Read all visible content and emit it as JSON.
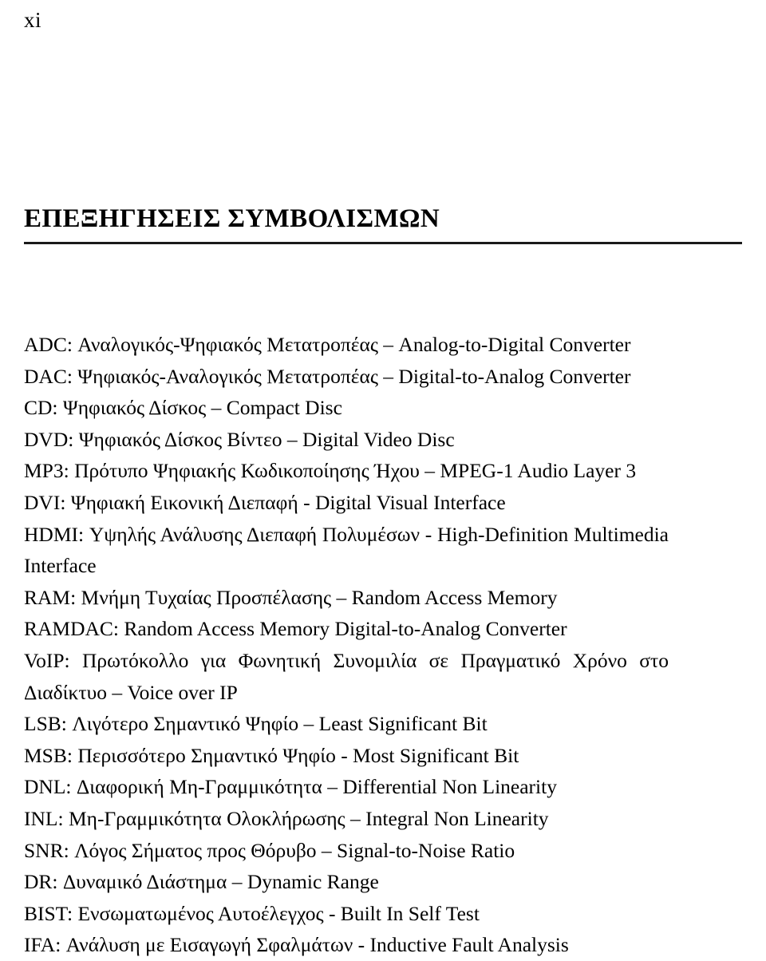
{
  "page": {
    "folio": "xi",
    "heading": "ΕΠΕΞΗΓΗΣΕΙΣ ΣΥΜΒΟΛΙΣΜΩΝ"
  },
  "glossary": {
    "entries": [
      {
        "text": "ADC: Αναλογικός-Ψηφιακός Μετατροπέας – Analog-to-Digital Converter"
      },
      {
        "text": "DAC: Ψηφιακός-Αναλογικός Μετατροπέας – Digital-to-Analog Converter"
      },
      {
        "text": "CD: Ψηφιακός Δίσκος – Compact Disc"
      },
      {
        "text": "DVD: Ψηφιακός Δίσκος Βίντεο – Digital Video Disc"
      },
      {
        "text": "MP3: Πρότυπο Ψηφιακής Κωδικοποίησης Ήχου – MPEG-1 Audio Layer 3"
      },
      {
        "text": "DVI: Ψηφιακή Εικονική Διεπαφή - Digital Visual Interface"
      },
      {
        "text": "HDMI: Υψηλής Ανάλυσης Διεπαφή Πολυμέσων - High-Definition Multimedia Interface"
      },
      {
        "text": "RAM: Μνήμη Τυχαίας Προσπέλασης – Random Access Memory"
      },
      {
        "text": "RAMDAC: Random Access Memory Digital-to-Analog Converter"
      },
      {
        "text": "VoIP: Πρωτόκολλο για Φωνητική Συνομιλία σε Πραγματικό Χρόνο στο Διαδίκτυο – Voice over IP"
      },
      {
        "text": "LSB: Λιγότερο Σημαντικό Ψηφίο – Least Significant Bit"
      },
      {
        "text": "MSB: Περισσότερο Σημαντικό Ψηφίο - Most Significant Bit"
      },
      {
        "text": "DNL: Διαφορική Μη-Γραμμικότητα – Differential Non Linearity"
      },
      {
        "text": "INL: Μη-Γραμμικότητα Ολοκλήρωσης – Integral Non Linearity"
      },
      {
        "text": "SNR: Λόγος Σήματος προς Θόρυβο – Signal-to-Noise Ratio"
      },
      {
        "text": "DR: Δυναμικό Διάστημα – Dynamic Range"
      },
      {
        "text": "BIST: Ενσωματωμένος Αυτοέλεγχος - Built In Self Test"
      },
      {
        "text": "IFA: Ανάλυση με Εισαγωγή Σφαλμάτων - Inductive Fault Analysis"
      }
    ]
  }
}
